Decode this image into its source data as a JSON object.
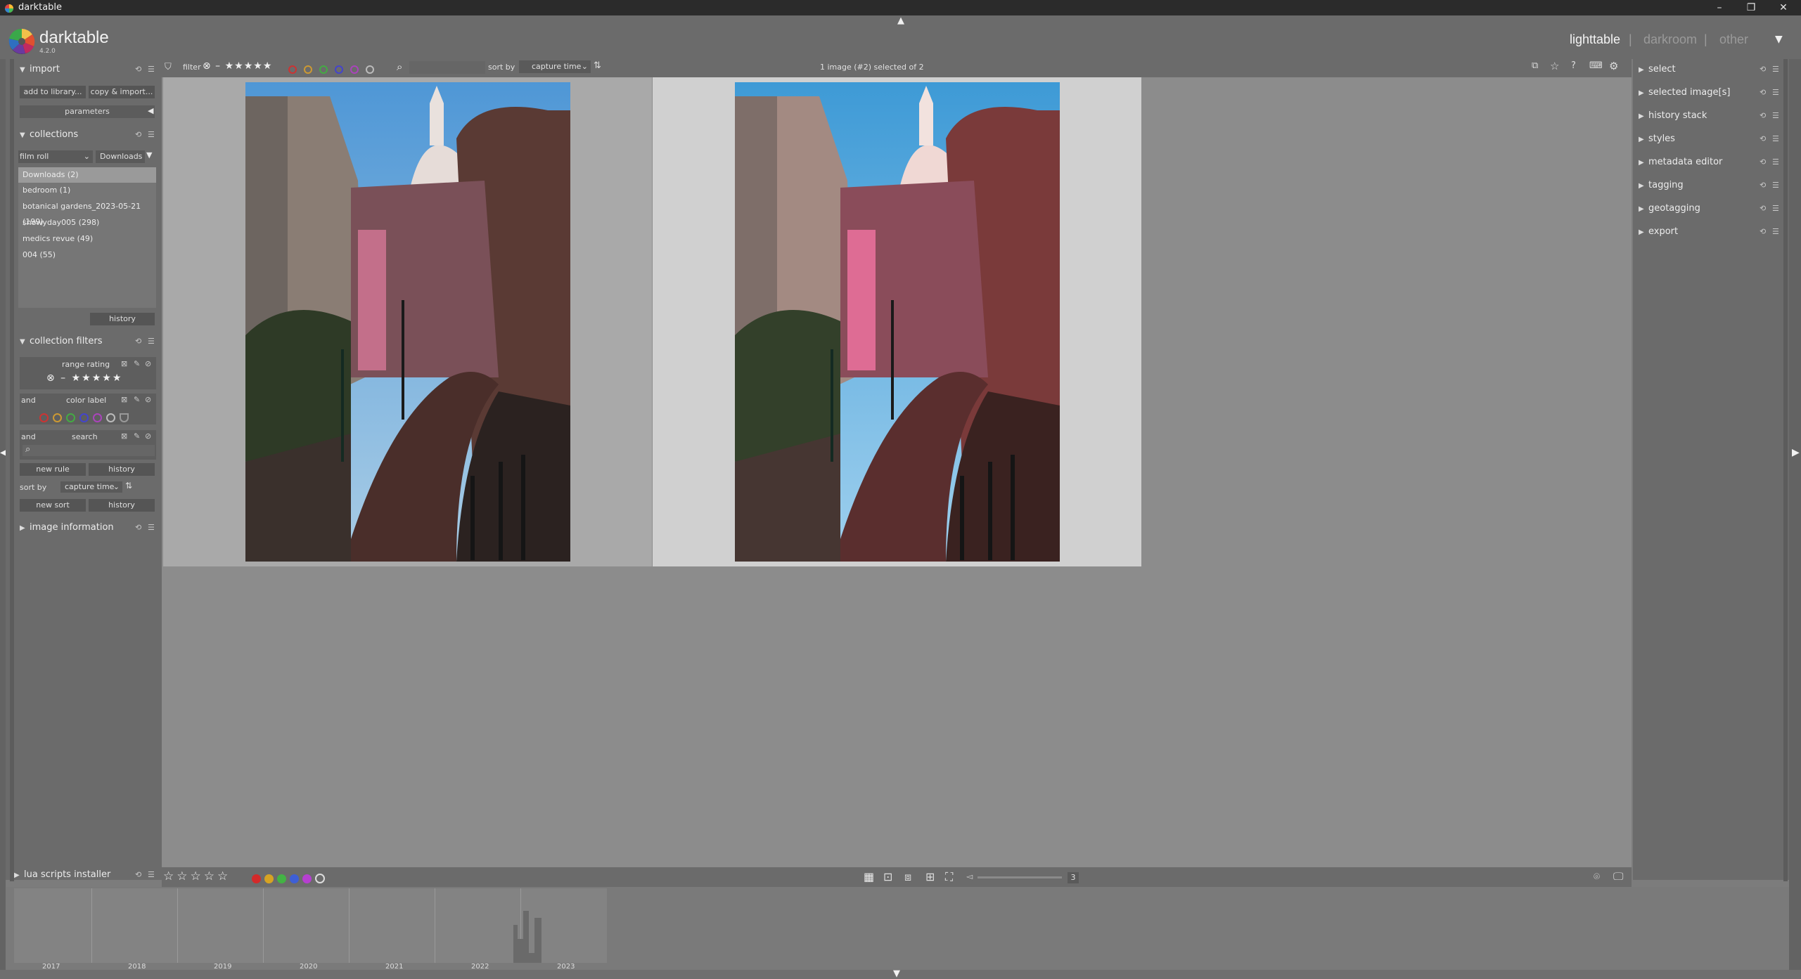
{
  "window": {
    "title": "darktable"
  },
  "header": {
    "logo": "darktable",
    "version": "4.2.0",
    "views": [
      "lighttable",
      "|",
      "darkroom",
      "|",
      "other"
    ],
    "active_view": "lighttable"
  },
  "top_toolbar": {
    "filter_label": "filter",
    "search_placeholder": "",
    "sort_label": "sort by",
    "sort_value": "capture time",
    "selection_info": "1 image (#2) selected of 2"
  },
  "left_panel": {
    "import": {
      "title": "import",
      "add_button": "add to library...",
      "copy_button": "copy & import...",
      "parameters": "parameters"
    },
    "collections": {
      "title": "collections",
      "property": "film roll",
      "value": "Downloads",
      "items": [
        "Downloads (2)",
        "bedroom (1)",
        "botanical gardens_2023-05-21 (199)",
        "snowyday005 (298)",
        "medics revue (49)",
        "004 (55)"
      ],
      "history_button": "history"
    },
    "collection_filters": {
      "title": "collection filters",
      "rules": [
        {
          "op": "",
          "name": "range rating"
        },
        {
          "op": "and",
          "name": "color label"
        },
        {
          "op": "and",
          "name": "search"
        }
      ],
      "new_rule": "new rule",
      "history1": "history",
      "sort_label": "sort by",
      "sort_value": "capture time",
      "new_sort": "new sort",
      "history2": "history"
    },
    "image_information": {
      "title": "image information"
    },
    "lua": {
      "title": "lua scripts installer"
    }
  },
  "right_panel": {
    "modules": [
      "select",
      "selected image[s]",
      "history stack",
      "styles",
      "metadata editor",
      "tagging",
      "geotagging",
      "export"
    ]
  },
  "bottom_toolbar": {
    "zoom_count": "3",
    "color_labels": [
      "#d32a2a",
      "#d6a323",
      "#43b344",
      "#3e5fd6",
      "#b63fd0"
    ]
  },
  "timeline": {
    "years": [
      "2017",
      "2018",
      "2019",
      "2020",
      "2021",
      "2022",
      "2023"
    ]
  },
  "colors": {
    "panel": "#6b6b6b",
    "center": "#8c8c8c",
    "selected_thumb_bg": "#d0d0d0",
    "thumb_bg": "#a9a9a9"
  }
}
